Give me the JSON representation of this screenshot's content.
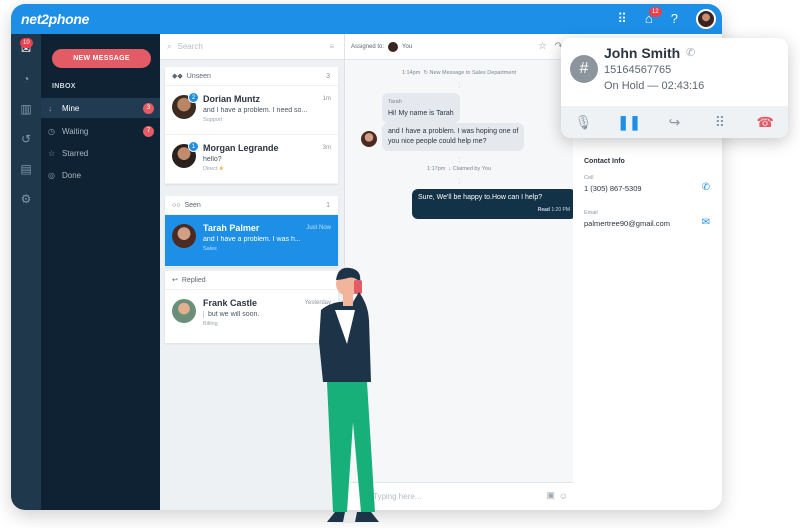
{
  "app": {
    "logo": "net2phone",
    "notif_count": "12"
  },
  "rail": {
    "mail_badge": "10"
  },
  "sidebar": {
    "new_message": "NEW MESSAGE",
    "inbox_label": "INBOX",
    "items": [
      {
        "label": "Mine",
        "count": "3",
        "icon": "arrow-down-icon"
      },
      {
        "label": "Waiting",
        "count": "7",
        "icon": "clock-icon"
      },
      {
        "label": "Starred",
        "count": "",
        "icon": "star-icon"
      },
      {
        "label": "Done",
        "count": "",
        "icon": "check-circle-icon"
      }
    ]
  },
  "list": {
    "search_placeholder": "Search",
    "unseen": {
      "label": "Unseen",
      "count": "3"
    },
    "seen": {
      "label": "Seen",
      "count": "1"
    },
    "replied": {
      "label": "Replied"
    },
    "conversations": [
      {
        "name": "Dorian Muntz",
        "time": "1m",
        "preview": "and I have a problem. I need so...",
        "tag": "Support",
        "badge": "2"
      },
      {
        "name": "Morgan Legrande",
        "time": "3m",
        "preview": "hello?",
        "tag": "Direct",
        "badge": "1"
      },
      {
        "name": "Tarah Palmer",
        "time": "Just Now",
        "preview": "and I have a problem. I was h...",
        "tag": "Sales"
      },
      {
        "name": "Frank Castle",
        "time": "Yesterday",
        "preview": "but we will soon.",
        "tag": "Billing"
      }
    ]
  },
  "chat": {
    "assigned_to_label": "Assigned to:",
    "assigned_to": "You",
    "sys1_time": "1:14pm",
    "sys1_text": "New Message to Sales Department",
    "sys2_time": "1:17pm",
    "sys2_text": "Claimed by You",
    "msg1_sender": "Tarah",
    "msg1_text": "Hi! My name is Tarah",
    "msg2_text1": "and I have a problem. I was hoping one of",
    "msg2_text2": "you nice people could help me?",
    "reply_text": "Sure, We'll be happy to.How can I help?",
    "reply_read": "Read",
    "reply_time": "1:20 PM",
    "typing_placeholder": "Typing here..."
  },
  "contact": {
    "title": "Contact Info",
    "cell_label": "Cell",
    "cell_value": "1 (305) 867-5309",
    "email_label": "Email",
    "email_value": "palmertree90@gmail.com"
  },
  "call": {
    "name": "John Smith",
    "number": "15164567765",
    "status": "On Hold — 02:43:16"
  },
  "colors": {
    "accent": "#1d8fe6",
    "danger": "#e35b64",
    "dark": "#0e2233"
  }
}
